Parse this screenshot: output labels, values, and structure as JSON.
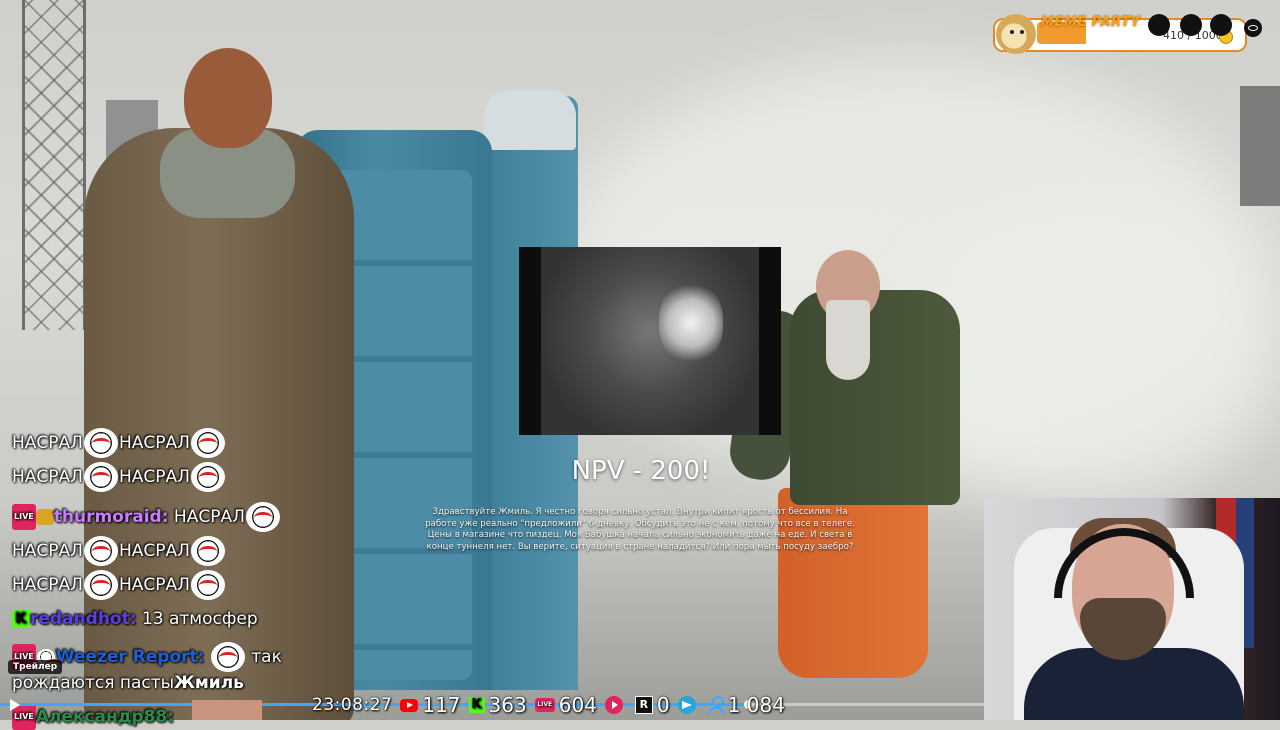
{
  "overlay": {
    "title": "NPV - 200!",
    "message": "Здравствуйте Жмиль. Я честно говоря сильно устал. Внутри кипит ярость от бессилия. На работе уже реально \"предложили\" 6-дневку. Обсудить это не с кем, потому что все в телеге. Цены в магазине что пиздец. Моя Бабушка начала сильно экономить даже на еде. И света в конце туннеля нет. Вы верите, ситуация в стране наладится? Или пора мыть посуду заебро?"
  },
  "meme_party": {
    "title": "MEME PARTY",
    "progress_text": "410 / 1000",
    "progress_fraction": 0.41,
    "accent_color": "#f29a2e",
    "icon": "doge-icon"
  },
  "chat": {
    "messages": [
      {
        "text1": "НАСРАЛ",
        "text2": "НАСРАЛ"
      },
      {
        "text1": "НАСРАЛ",
        "text2": "НАСРАЛ"
      },
      {
        "badge": "LIVE",
        "user": "thurmoraid:",
        "text1": "НАСРАЛ"
      },
      {
        "text1": "НАСРАЛ",
        "text2": "НАСРАЛ"
      },
      {
        "text1": "НАСРАЛ",
        "text2": "НАСРАЛ"
      },
      {
        "badge": "K",
        "user": "redandhot:",
        "text1": "13 атмосфер"
      },
      {
        "badge": "LIVE",
        "user": "Weezer Report:",
        "text1": "так"
      },
      {
        "text1": "рождаются пасты",
        "bold": "Жмиль"
      },
      {
        "badge": "LIVE",
        "user": "Александр88:"
      }
    ]
  },
  "player": {
    "label": "Трейлер",
    "progress_fraction": 0.76
  },
  "stats": {
    "time": "23:08:27",
    "youtube": "117",
    "kick": "363",
    "vk": "604",
    "red_play": "0",
    "rutube_icon": "R",
    "telegram": "",
    "viewers": "1 084",
    "vk_icon_text": "LIVE",
    "kick_icon_text": "K"
  }
}
